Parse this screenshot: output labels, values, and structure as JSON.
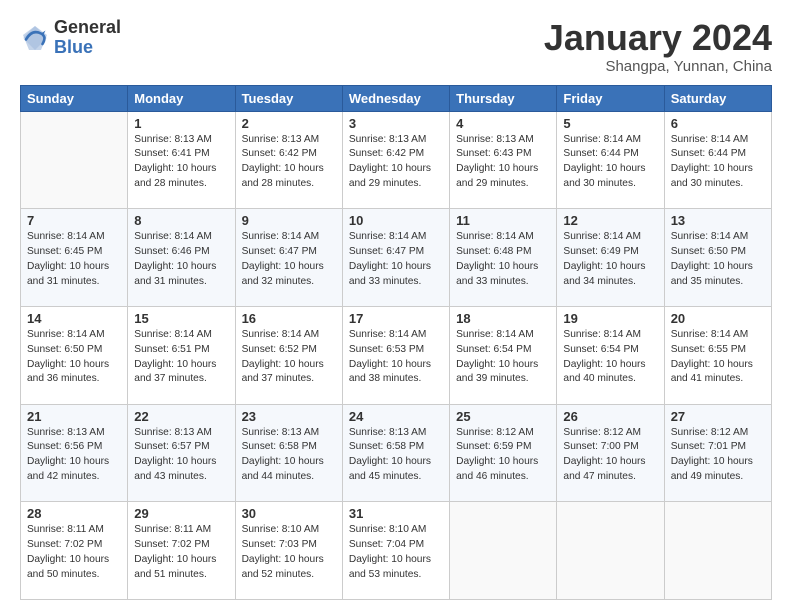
{
  "header": {
    "logo_line1": "General",
    "logo_line2": "Blue",
    "month_title": "January 2024",
    "location": "Shangpa, Yunnan, China"
  },
  "days_of_week": [
    "Sunday",
    "Monday",
    "Tuesday",
    "Wednesday",
    "Thursday",
    "Friday",
    "Saturday"
  ],
  "weeks": [
    [
      {
        "day": "",
        "content": ""
      },
      {
        "day": "1",
        "content": "Sunrise: 8:13 AM\nSunset: 6:41 PM\nDaylight: 10 hours\nand 28 minutes."
      },
      {
        "day": "2",
        "content": "Sunrise: 8:13 AM\nSunset: 6:42 PM\nDaylight: 10 hours\nand 28 minutes."
      },
      {
        "day": "3",
        "content": "Sunrise: 8:13 AM\nSunset: 6:42 PM\nDaylight: 10 hours\nand 29 minutes."
      },
      {
        "day": "4",
        "content": "Sunrise: 8:13 AM\nSunset: 6:43 PM\nDaylight: 10 hours\nand 29 minutes."
      },
      {
        "day": "5",
        "content": "Sunrise: 8:14 AM\nSunset: 6:44 PM\nDaylight: 10 hours\nand 30 minutes."
      },
      {
        "day": "6",
        "content": "Sunrise: 8:14 AM\nSunset: 6:44 PM\nDaylight: 10 hours\nand 30 minutes."
      }
    ],
    [
      {
        "day": "7",
        "content": "Sunrise: 8:14 AM\nSunset: 6:45 PM\nDaylight: 10 hours\nand 31 minutes."
      },
      {
        "day": "8",
        "content": "Sunrise: 8:14 AM\nSunset: 6:46 PM\nDaylight: 10 hours\nand 31 minutes."
      },
      {
        "day": "9",
        "content": "Sunrise: 8:14 AM\nSunset: 6:47 PM\nDaylight: 10 hours\nand 32 minutes."
      },
      {
        "day": "10",
        "content": "Sunrise: 8:14 AM\nSunset: 6:47 PM\nDaylight: 10 hours\nand 33 minutes."
      },
      {
        "day": "11",
        "content": "Sunrise: 8:14 AM\nSunset: 6:48 PM\nDaylight: 10 hours\nand 33 minutes."
      },
      {
        "day": "12",
        "content": "Sunrise: 8:14 AM\nSunset: 6:49 PM\nDaylight: 10 hours\nand 34 minutes."
      },
      {
        "day": "13",
        "content": "Sunrise: 8:14 AM\nSunset: 6:50 PM\nDaylight: 10 hours\nand 35 minutes."
      }
    ],
    [
      {
        "day": "14",
        "content": "Sunrise: 8:14 AM\nSunset: 6:50 PM\nDaylight: 10 hours\nand 36 minutes."
      },
      {
        "day": "15",
        "content": "Sunrise: 8:14 AM\nSunset: 6:51 PM\nDaylight: 10 hours\nand 37 minutes."
      },
      {
        "day": "16",
        "content": "Sunrise: 8:14 AM\nSunset: 6:52 PM\nDaylight: 10 hours\nand 37 minutes."
      },
      {
        "day": "17",
        "content": "Sunrise: 8:14 AM\nSunset: 6:53 PM\nDaylight: 10 hours\nand 38 minutes."
      },
      {
        "day": "18",
        "content": "Sunrise: 8:14 AM\nSunset: 6:54 PM\nDaylight: 10 hours\nand 39 minutes."
      },
      {
        "day": "19",
        "content": "Sunrise: 8:14 AM\nSunset: 6:54 PM\nDaylight: 10 hours\nand 40 minutes."
      },
      {
        "day": "20",
        "content": "Sunrise: 8:14 AM\nSunset: 6:55 PM\nDaylight: 10 hours\nand 41 minutes."
      }
    ],
    [
      {
        "day": "21",
        "content": "Sunrise: 8:13 AM\nSunset: 6:56 PM\nDaylight: 10 hours\nand 42 minutes."
      },
      {
        "day": "22",
        "content": "Sunrise: 8:13 AM\nSunset: 6:57 PM\nDaylight: 10 hours\nand 43 minutes."
      },
      {
        "day": "23",
        "content": "Sunrise: 8:13 AM\nSunset: 6:58 PM\nDaylight: 10 hours\nand 44 minutes."
      },
      {
        "day": "24",
        "content": "Sunrise: 8:13 AM\nSunset: 6:58 PM\nDaylight: 10 hours\nand 45 minutes."
      },
      {
        "day": "25",
        "content": "Sunrise: 8:12 AM\nSunset: 6:59 PM\nDaylight: 10 hours\nand 46 minutes."
      },
      {
        "day": "26",
        "content": "Sunrise: 8:12 AM\nSunset: 7:00 PM\nDaylight: 10 hours\nand 47 minutes."
      },
      {
        "day": "27",
        "content": "Sunrise: 8:12 AM\nSunset: 7:01 PM\nDaylight: 10 hours\nand 49 minutes."
      }
    ],
    [
      {
        "day": "28",
        "content": "Sunrise: 8:11 AM\nSunset: 7:02 PM\nDaylight: 10 hours\nand 50 minutes."
      },
      {
        "day": "29",
        "content": "Sunrise: 8:11 AM\nSunset: 7:02 PM\nDaylight: 10 hours\nand 51 minutes."
      },
      {
        "day": "30",
        "content": "Sunrise: 8:10 AM\nSunset: 7:03 PM\nDaylight: 10 hours\nand 52 minutes."
      },
      {
        "day": "31",
        "content": "Sunrise: 8:10 AM\nSunset: 7:04 PM\nDaylight: 10 hours\nand 53 minutes."
      },
      {
        "day": "",
        "content": ""
      },
      {
        "day": "",
        "content": ""
      },
      {
        "day": "",
        "content": ""
      }
    ]
  ]
}
